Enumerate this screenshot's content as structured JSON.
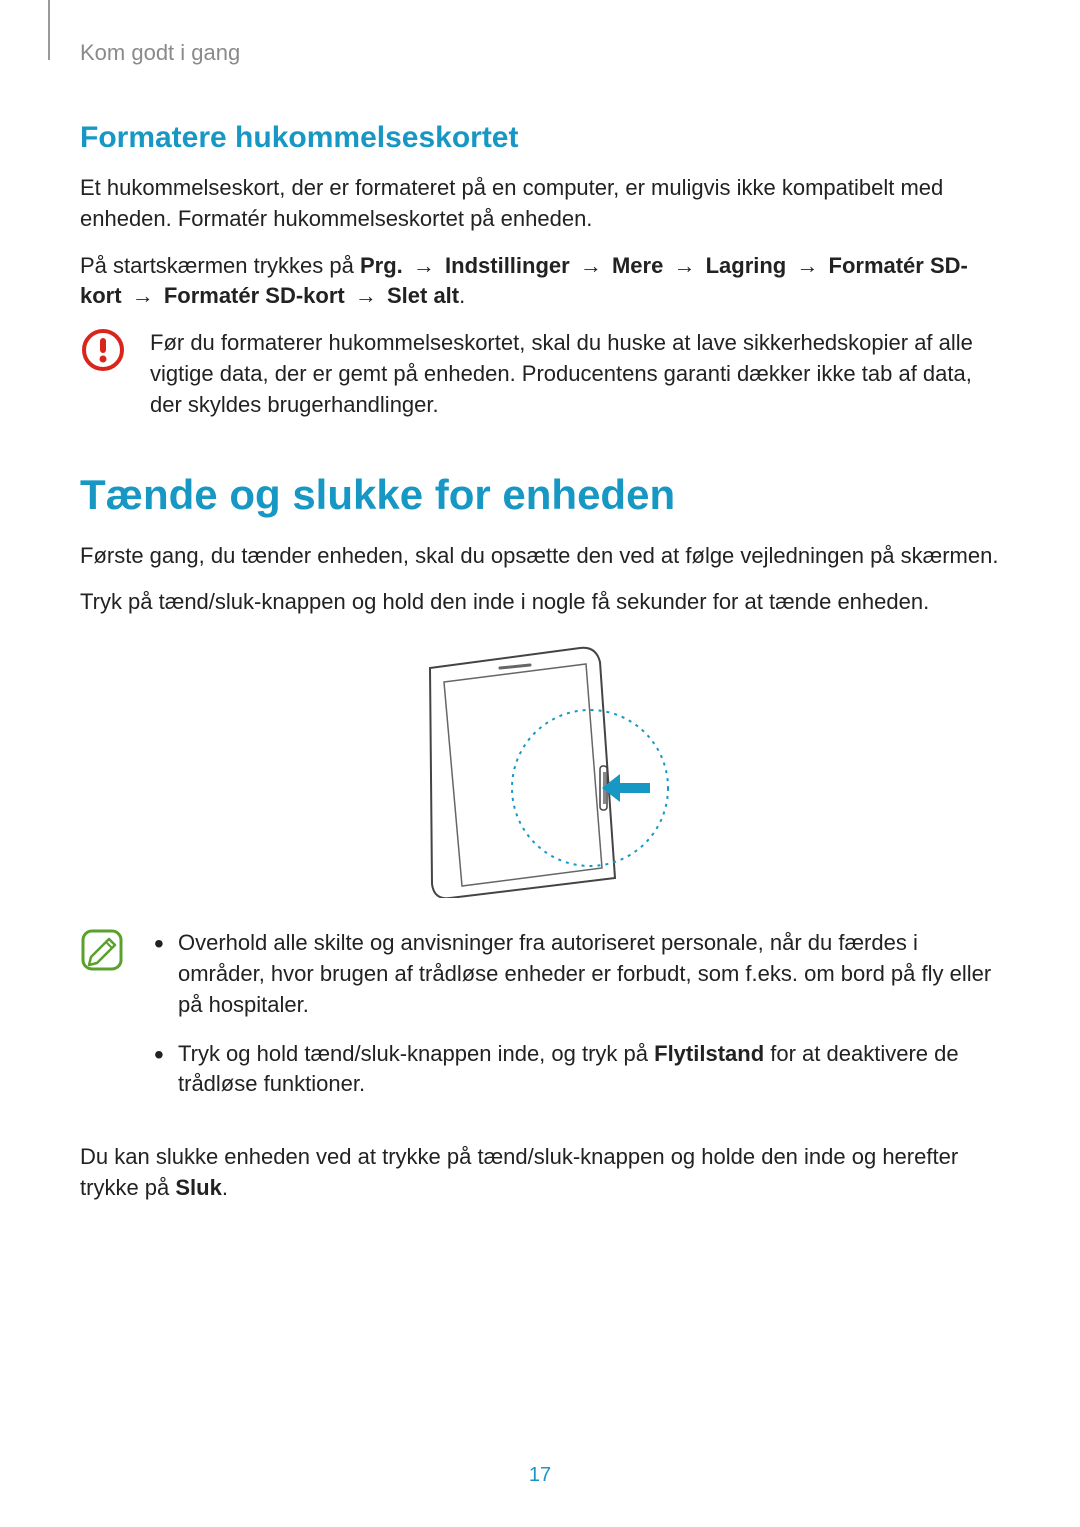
{
  "breadcrumb": "Kom godt i gang",
  "section1": {
    "heading": "Formatere hukommelseskortet",
    "p1": "Et hukommelseskort, der er formateret på en computer, er muligvis ikke kompatibelt med enheden. Formatér hukommelseskortet på enheden.",
    "p2_pre": "På startskærmen trykkes på ",
    "p2_b1": "Prg.",
    "p2_b2": "Indstillinger",
    "p2_b3": "Mere",
    "p2_b4": "Lagring",
    "p2_b5": "Formatér SD-kort",
    "p2_b6": "Formatér SD-kort",
    "p2_b7": "Slet alt",
    "arrow": "→",
    "period": ".",
    "warning": "Før du formaterer hukommelseskortet, skal du huske at lave sikkerhedskopier af alle vigtige data, der er gemt på enheden. Producentens garanti dækker ikke tab af data, der skyldes brugerhandlinger."
  },
  "section2": {
    "title": "Tænde og slukke for enheden",
    "p1": "Første gang, du tænder enheden, skal du opsætte den ved at følge vejledningen på skærmen.",
    "p2": "Tryk på tænd/sluk-knappen og hold den inde i nogle få sekunder for at tænde enheden.",
    "note1": "Overhold alle skilte og anvisninger fra autoriseret personale, når du færdes i områder, hvor brugen af trådløse enheder er forbudt, som f.eks. om bord på fly eller på hospitaler.",
    "note2_pre": "Tryk og hold tænd/sluk-knappen inde, og tryk på ",
    "note2_bold": "Flytilstand",
    "note2_post": " for at deaktivere de trådløse funktioner.",
    "p3_pre": "Du kan slukke enheden ved at trykke på tænd/sluk-knappen og holde den inde og herefter trykke på ",
    "p3_bold": "Sluk",
    "p3_post": "."
  },
  "page_number": "17"
}
